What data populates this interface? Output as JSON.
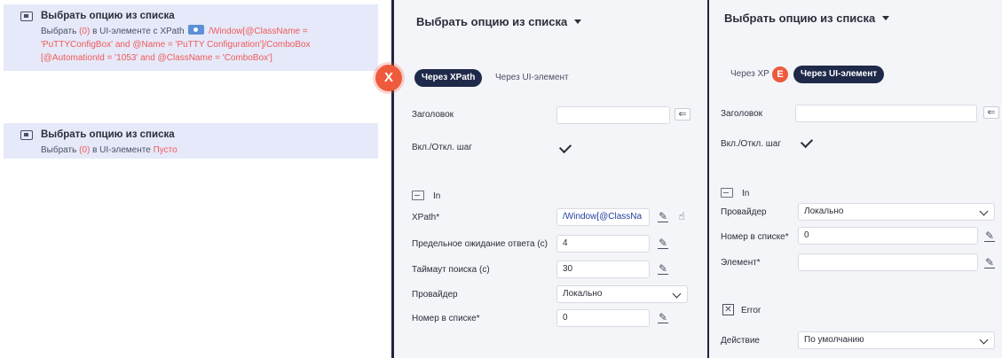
{
  "left": {
    "step1": {
      "title": "Выбрать опцию из списка",
      "desc_prefix": "Выбрать",
      "desc_value": "(0)",
      "desc_mid": "в UI-элементе с XPath",
      "xpath": "/Window[@ClassName = 'PuTTYConfigBox' and @Name = 'PuTTY Configuration']/ComboBox [@AutomationId = '1053' and @ClassName = 'ComboBox']"
    },
    "step2": {
      "title": "Выбрать опцию из списка",
      "desc_prefix": "Выбрать",
      "desc_value": "(0)",
      "desc_mid": "в UI-элементе",
      "empty": "Пусто"
    }
  },
  "panel1": {
    "title": "Выбрать опцию из списка",
    "badge": "X",
    "tab_xpath": "Через XPath",
    "tab_ui": "Через UI-элемент",
    "header_label": "Заголовок",
    "header_value": "",
    "toggle_label": "Вкл./Откл. шаг",
    "in_label": "In",
    "xpath_label": "XPath*",
    "xpath_value": "/Window[@ClassNa",
    "timeout_label": "Предельное ожидание ответа (с)",
    "timeout_value": "4",
    "search_label": "Таймаут поиска (с)",
    "search_value": "30",
    "provider_label": "Провайдер",
    "provider_value": "Локально",
    "index_label": "Номер в списке*",
    "index_value": "0"
  },
  "panel2": {
    "title": "Выбрать опцию из списка",
    "badge": "E",
    "tab_xpath": "Через XP",
    "tab_ui": "Через UI-элемент",
    "header_label": "Заголовок",
    "header_value": "",
    "toggle_label": "Вкл./Откл. шаг",
    "in_label": "In",
    "provider_label": "Провайдер",
    "provider_value": "Локально",
    "index_label": "Номер в списке*",
    "index_value": "0",
    "element_label": "Элемент*",
    "element_value": "",
    "error_label": "Error",
    "action_label": "Действие",
    "action_value": "По умолчанию"
  }
}
